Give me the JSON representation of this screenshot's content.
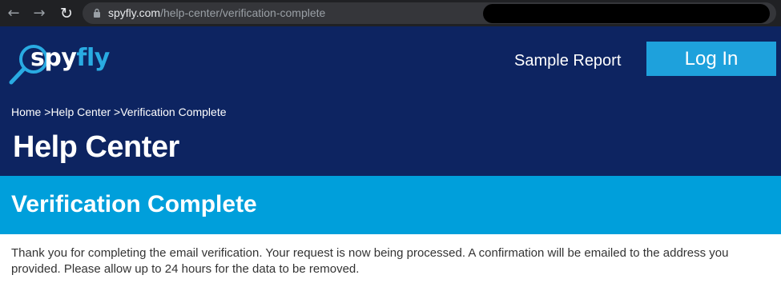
{
  "browser": {
    "back_icon": "arrow-left-icon",
    "forward_icon": "arrow-right-icon",
    "reload_icon": "reload-icon",
    "url_host": "spyfly.com",
    "url_path": "/help-center/verification-complete"
  },
  "header": {
    "logo_spy": "spy",
    "logo_fly": "fly",
    "nav_sample_report": "Sample Report",
    "login_label": "Log In",
    "colors": {
      "header_bg": "#0d2461",
      "accent": "#1ea1dc"
    }
  },
  "breadcrumb": {
    "items": [
      "Home",
      "Help Center",
      "Verification Complete"
    ],
    "separator": " >"
  },
  "page": {
    "title": "Help Center",
    "section_title": "Verification Complete",
    "body": "Thank you for completing the email verification. Your request is now being processed. A confirmation will be emailed to the address you provided. Please allow up to 24 hours for the data to be removed."
  }
}
